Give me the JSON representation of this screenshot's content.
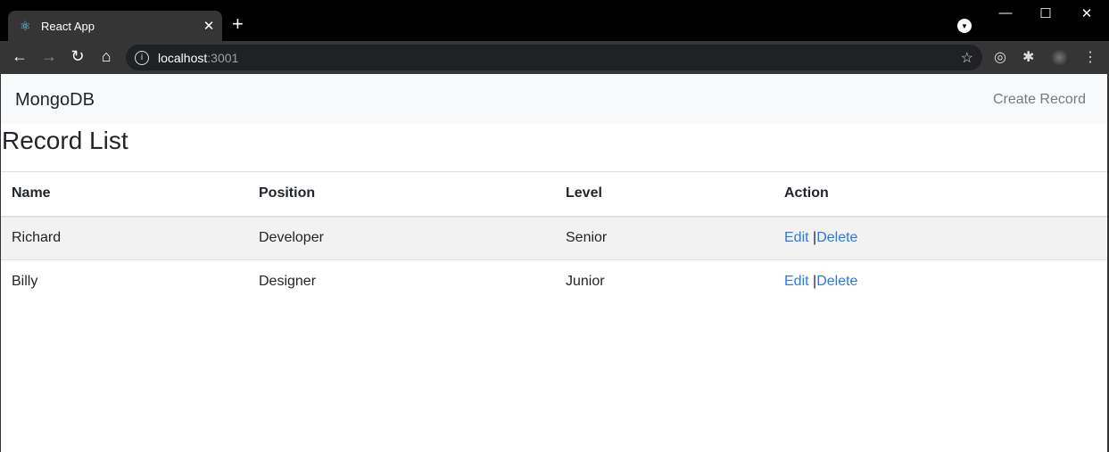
{
  "browser": {
    "tab_title": "React App",
    "url_host": "localhost",
    "url_port": ":3001"
  },
  "navbar": {
    "brand": "MongoDB",
    "create_link": "Create Record"
  },
  "page": {
    "title": "Record List"
  },
  "table": {
    "headers": [
      "Name",
      "Position",
      "Level",
      "Action"
    ],
    "rows": [
      {
        "name": "Richard",
        "position": "Developer",
        "level": "Senior",
        "edit": "Edit",
        "sep": " |",
        "delete": "Delete"
      },
      {
        "name": "Billy",
        "position": "Designer",
        "level": "Junior",
        "edit": "Edit",
        "sep": " |",
        "delete": "Delete"
      }
    ]
  }
}
